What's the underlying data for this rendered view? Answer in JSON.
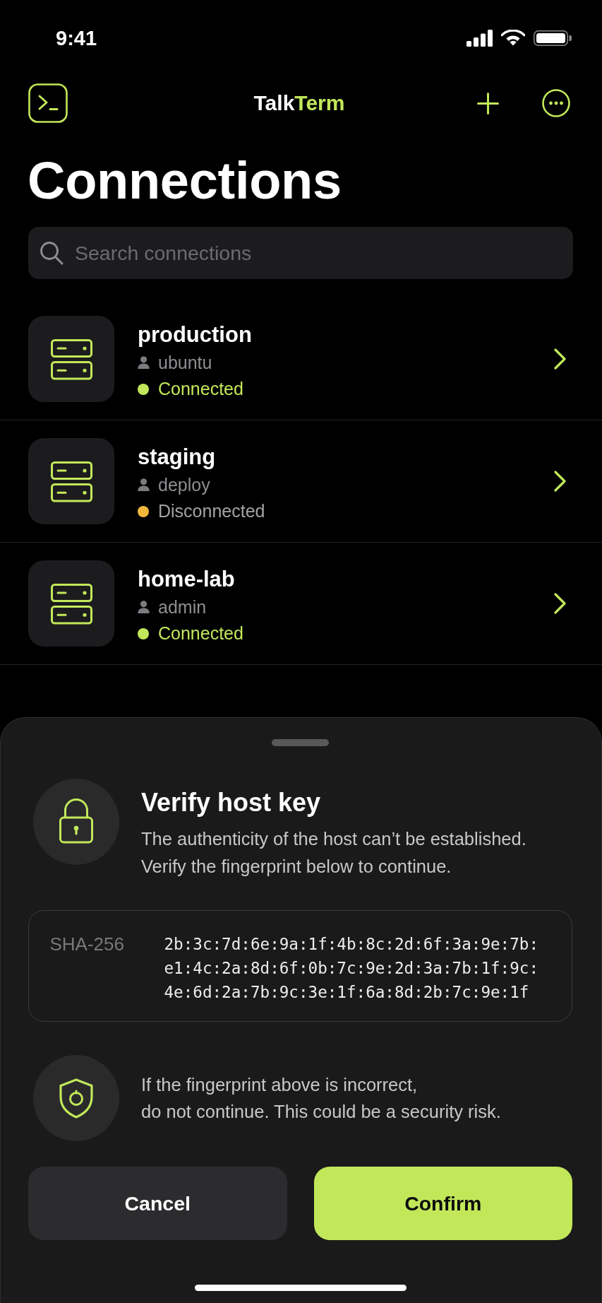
{
  "status_bar": {
    "time": "9:41"
  },
  "nav_bar": {
    "title": {
      "main": "Talk",
      "accent": "Term"
    }
  },
  "page_title": "Connections",
  "search": {
    "placeholder": "Search connections"
  },
  "connections": [
    {
      "name": "production",
      "user": "ubuntu",
      "status": "Connected",
      "connected": true,
      "color": "#c2e85a"
    },
    {
      "name": "staging",
      "user": "deploy",
      "status": "Disconnected",
      "connected": false,
      "color": "#f1b73c"
    },
    {
      "name": "home-lab",
      "user": "admin",
      "status": "Connected",
      "connected": true,
      "color": "#c2e85a"
    }
  ],
  "sheet": {
    "title": "Verify host key",
    "description": "The authenticity of the host can’t be established.\nVerify the fingerprint below to continue.",
    "fingerprint": {
      "label": "SHA-256",
      "value": "2b:3c:7d:6e:9a:1f:4b:8c:2d:6f:3a:9e:7b:e1:4c:2a:8d:6f:0b:7c:9e:2d:3a:7b:1f:9c:4e:6d:2a:7b:9c:3e:1f:6a:8d:2b:7c:9e:1f"
    },
    "warning": "If the fingerprint above is incorrect,\ndo not continue. This could be a security risk.",
    "buttons": [
      {
        "label": "Cancel",
        "kind": "secondary"
      },
      {
        "label": "Confirm",
        "kind": "primary"
      }
    ]
  }
}
